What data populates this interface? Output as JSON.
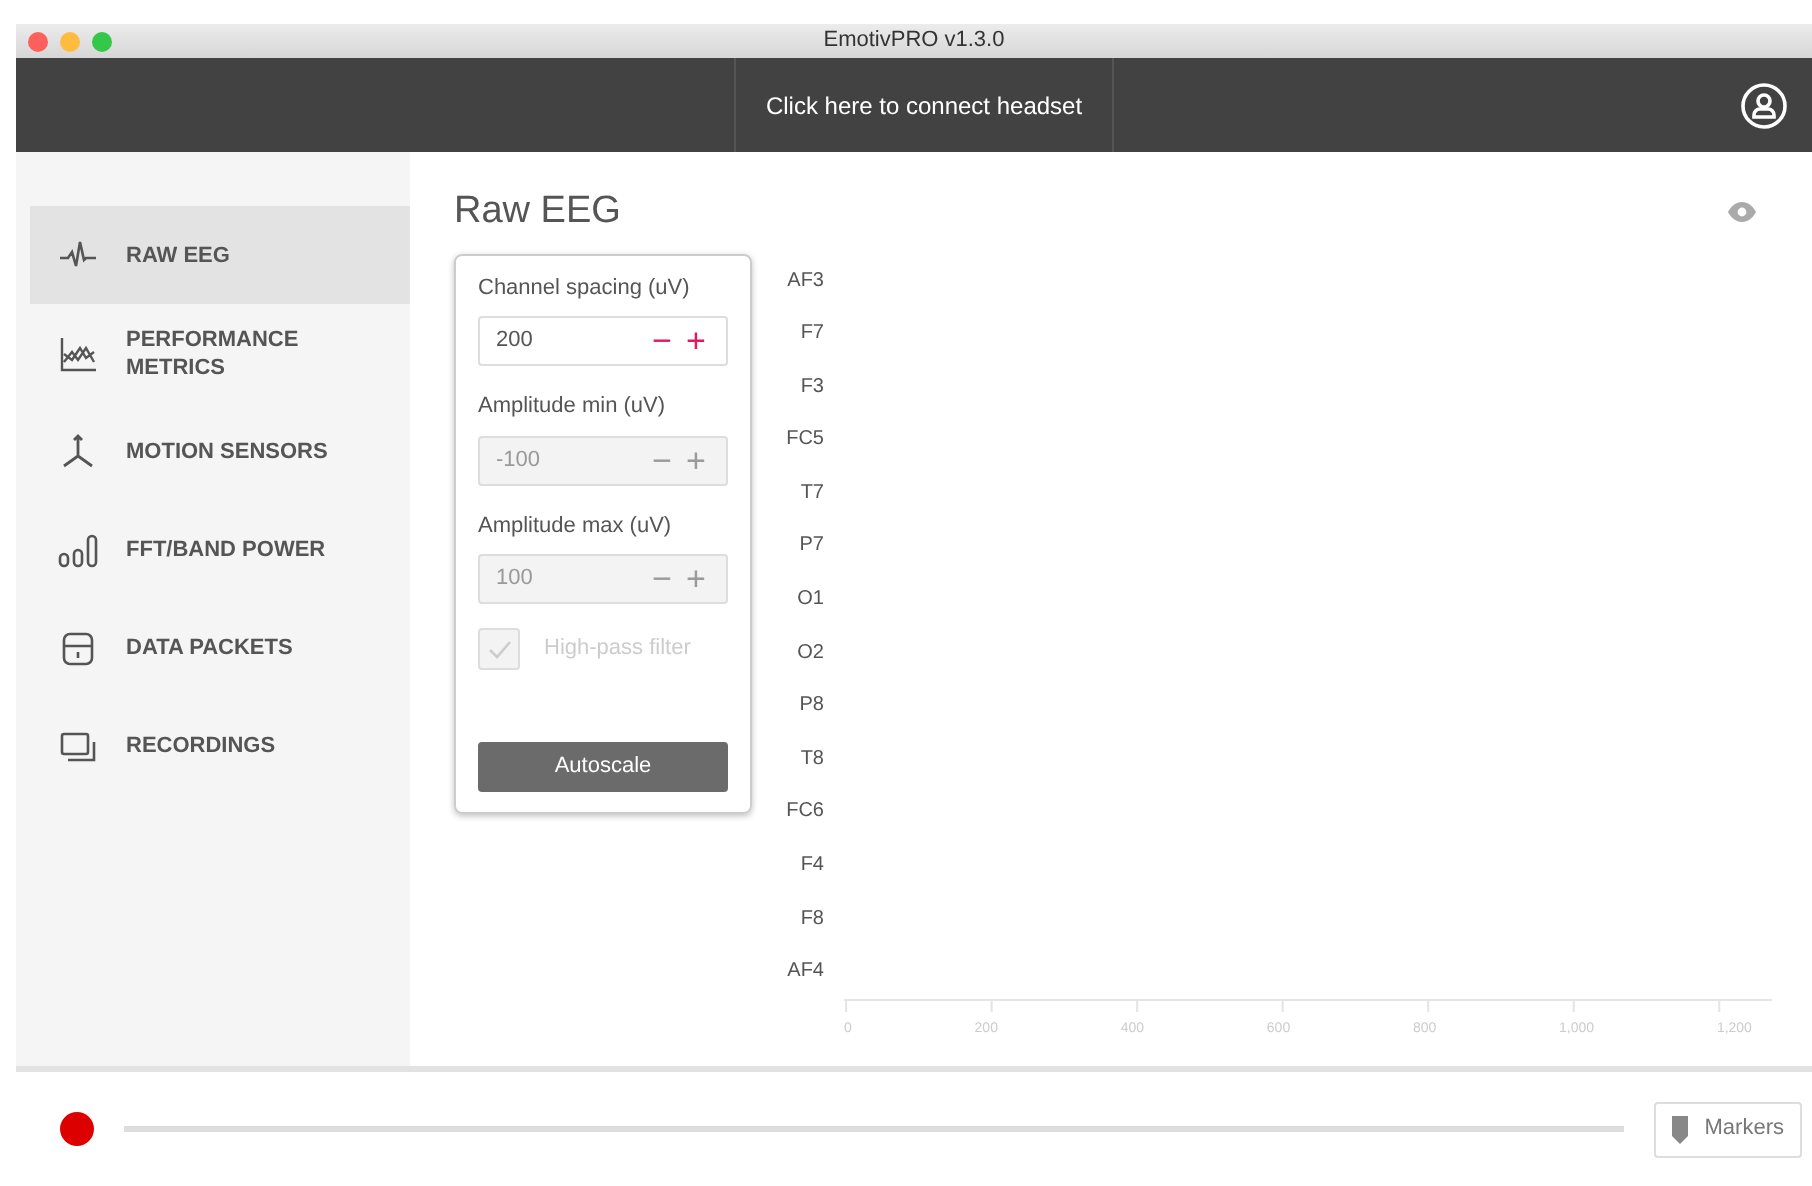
{
  "window": {
    "title": "EmotivPRO v1.3.0"
  },
  "header": {
    "connect_label": "Click here to connect headset"
  },
  "sidebar": {
    "items": [
      {
        "label": "RAW EEG",
        "kind": "wave",
        "selected": true
      },
      {
        "label": "PERFORMANCE METRICS",
        "kind": "metrics",
        "selected": false
      },
      {
        "label": "MOTION SENSORS",
        "kind": "motion",
        "selected": false
      },
      {
        "label": "FFT/BAND POWER",
        "kind": "bars",
        "selected": false
      },
      {
        "label": "DATA PACKETS",
        "kind": "packet",
        "selected": false
      },
      {
        "label": "RECORDINGS",
        "kind": "screens",
        "selected": false
      }
    ]
  },
  "page": {
    "title": "Raw EEG"
  },
  "settings": {
    "fields": [
      {
        "label": "Channel spacing (uV)",
        "value": "200",
        "disabled": false,
        "decrement": "−",
        "increment": "+"
      },
      {
        "label": "Amplitude min (uV)",
        "value": "-100",
        "disabled": true,
        "decrement": "−",
        "increment": "+"
      },
      {
        "label": "Amplitude max (uV)",
        "value": "100",
        "disabled": true,
        "decrement": "−",
        "increment": "+"
      }
    ],
    "high_pass": {
      "label": "High-pass filter",
      "checked": true,
      "disabled": true
    },
    "button": "Autoscale"
  },
  "channels": [
    "AF3",
    "F7",
    "F3",
    "FC5",
    "T7",
    "P7",
    "O1",
    "O2",
    "P8",
    "T8",
    "FC6",
    "F4",
    "F8",
    "AF4"
  ],
  "x_axis_labels": [
    "0",
    "200",
    "400",
    "600",
    "800",
    "1,000",
    "1,200"
  ],
  "footer": {
    "markers_label": "Markers"
  }
}
